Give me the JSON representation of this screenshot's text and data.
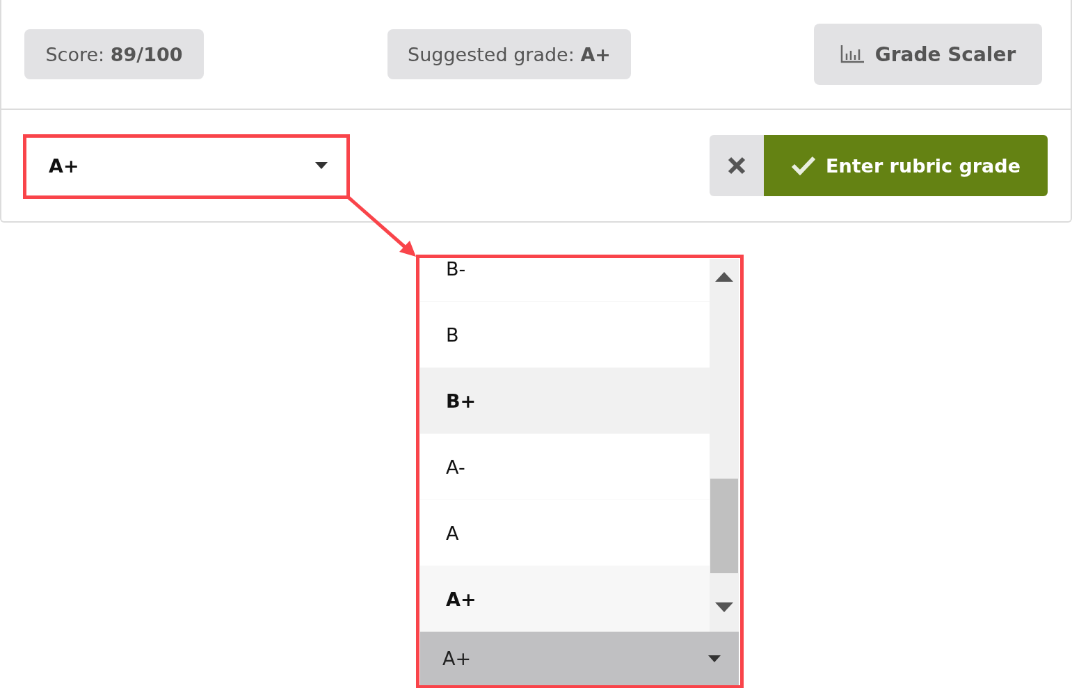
{
  "summary": {
    "score": "Score: **89/100**",
    "suggested_grade": "Suggested grade: **A+**",
    "scaler_button": "Grade Scaler"
  },
  "grade_select": {
    "value": "A+"
  },
  "actions": {
    "submit": "Enter rubric grade"
  },
  "dropdown": {
    "options": [
      {
        "label": "B-",
        "selected": false,
        "hovered": false
      },
      {
        "label": "B",
        "selected": false,
        "hovered": false
      },
      {
        "label": "B+",
        "selected": false,
        "hovered": true
      },
      {
        "label": "A-",
        "selected": false,
        "hovered": false
      },
      {
        "label": "A",
        "selected": false,
        "hovered": false
      },
      {
        "label": "A+",
        "selected": true,
        "hovered": false
      }
    ],
    "value": "A+"
  }
}
